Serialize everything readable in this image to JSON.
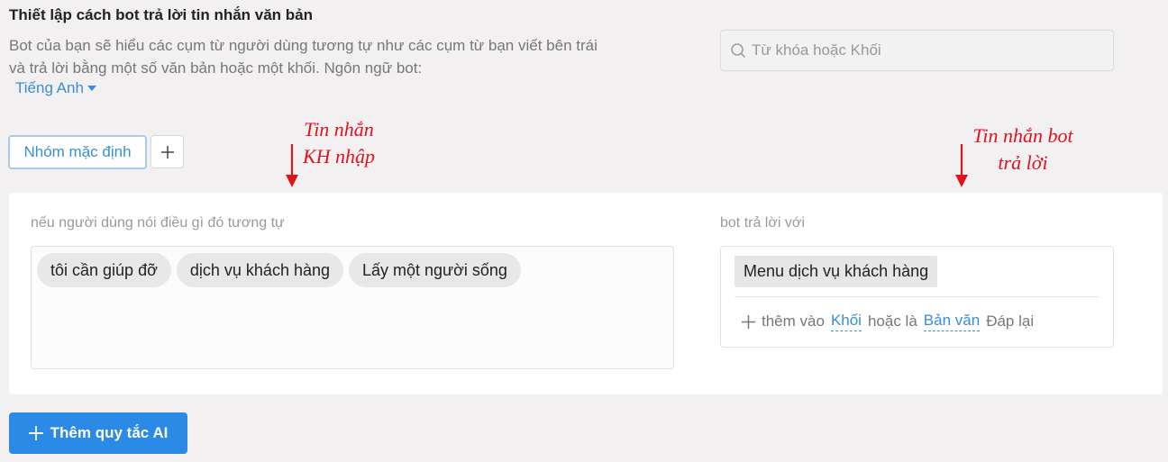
{
  "header": {
    "title": "Thiết lập cách bot trả lời tin nhắn văn bản",
    "description": "Bot của bạn sẽ hiểu các cụm từ người dùng tương tự như các cụm từ bạn viết bên trái và trả lời bằng một số văn bản hoặc một khối. Ngôn ngữ bot:",
    "language": "Tiếng Anh"
  },
  "search": {
    "placeholder": "Từ khóa hoặc Khối",
    "icon": "search-icon"
  },
  "groups": {
    "active_tab": "Nhóm mặc định",
    "add_icon": "plus-icon"
  },
  "annotations": {
    "user_line1": "Tin nhắn",
    "user_line2": "KH nhập",
    "bot_line1": "Tin nhắn bot",
    "bot_line2": "trả lời",
    "color": "#e0141e"
  },
  "rule": {
    "user_label": "nếu người dùng nói điều gì đó tương tự",
    "phrases": [
      "tôi cần giúp đỡ",
      "dịch vụ khách hàng",
      "Lấy một người sống"
    ],
    "bot_label": "bot trả lời với",
    "reply_block": "Menu dịch vụ khách hàng",
    "add_prefix": "thêm vào",
    "add_block_link": "Khối",
    "add_or": "hoặc là",
    "add_text_link": "Bản văn",
    "add_suffix": "Đáp lại"
  },
  "footer": {
    "add_rule_label": "Thêm quy tắc AI"
  },
  "colors": {
    "accent": "#3a8ed6",
    "button": "#2b8ae6"
  }
}
